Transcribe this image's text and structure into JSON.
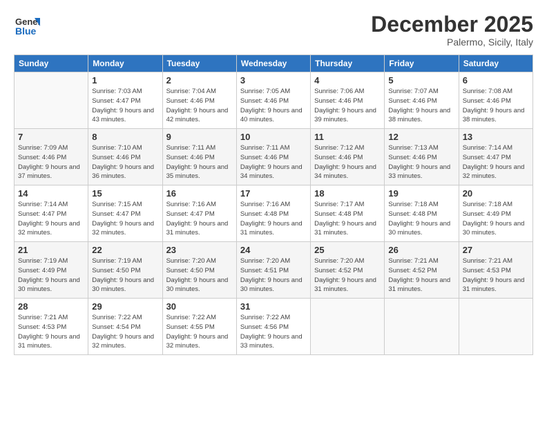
{
  "header": {
    "logo_general": "General",
    "logo_blue": "Blue",
    "month": "December 2025",
    "location": "Palermo, Sicily, Italy"
  },
  "weekdays": [
    "Sunday",
    "Monday",
    "Tuesday",
    "Wednesday",
    "Thursday",
    "Friday",
    "Saturday"
  ],
  "weeks": [
    [
      {
        "day": "",
        "sunrise": "",
        "sunset": "",
        "daylight": ""
      },
      {
        "day": "1",
        "sunrise": "Sunrise: 7:03 AM",
        "sunset": "Sunset: 4:47 PM",
        "daylight": "Daylight: 9 hours and 43 minutes."
      },
      {
        "day": "2",
        "sunrise": "Sunrise: 7:04 AM",
        "sunset": "Sunset: 4:46 PM",
        "daylight": "Daylight: 9 hours and 42 minutes."
      },
      {
        "day": "3",
        "sunrise": "Sunrise: 7:05 AM",
        "sunset": "Sunset: 4:46 PM",
        "daylight": "Daylight: 9 hours and 40 minutes."
      },
      {
        "day": "4",
        "sunrise": "Sunrise: 7:06 AM",
        "sunset": "Sunset: 4:46 PM",
        "daylight": "Daylight: 9 hours and 39 minutes."
      },
      {
        "day": "5",
        "sunrise": "Sunrise: 7:07 AM",
        "sunset": "Sunset: 4:46 PM",
        "daylight": "Daylight: 9 hours and 38 minutes."
      },
      {
        "day": "6",
        "sunrise": "Sunrise: 7:08 AM",
        "sunset": "Sunset: 4:46 PM",
        "daylight": "Daylight: 9 hours and 38 minutes."
      }
    ],
    [
      {
        "day": "7",
        "sunrise": "Sunrise: 7:09 AM",
        "sunset": "Sunset: 4:46 PM",
        "daylight": "Daylight: 9 hours and 37 minutes."
      },
      {
        "day": "8",
        "sunrise": "Sunrise: 7:10 AM",
        "sunset": "Sunset: 4:46 PM",
        "daylight": "Daylight: 9 hours and 36 minutes."
      },
      {
        "day": "9",
        "sunrise": "Sunrise: 7:11 AM",
        "sunset": "Sunset: 4:46 PM",
        "daylight": "Daylight: 9 hours and 35 minutes."
      },
      {
        "day": "10",
        "sunrise": "Sunrise: 7:11 AM",
        "sunset": "Sunset: 4:46 PM",
        "daylight": "Daylight: 9 hours and 34 minutes."
      },
      {
        "day": "11",
        "sunrise": "Sunrise: 7:12 AM",
        "sunset": "Sunset: 4:46 PM",
        "daylight": "Daylight: 9 hours and 34 minutes."
      },
      {
        "day": "12",
        "sunrise": "Sunrise: 7:13 AM",
        "sunset": "Sunset: 4:46 PM",
        "daylight": "Daylight: 9 hours and 33 minutes."
      },
      {
        "day": "13",
        "sunrise": "Sunrise: 7:14 AM",
        "sunset": "Sunset: 4:47 PM",
        "daylight": "Daylight: 9 hours and 32 minutes."
      }
    ],
    [
      {
        "day": "14",
        "sunrise": "Sunrise: 7:14 AM",
        "sunset": "Sunset: 4:47 PM",
        "daylight": "Daylight: 9 hours and 32 minutes."
      },
      {
        "day": "15",
        "sunrise": "Sunrise: 7:15 AM",
        "sunset": "Sunset: 4:47 PM",
        "daylight": "Daylight: 9 hours and 32 minutes."
      },
      {
        "day": "16",
        "sunrise": "Sunrise: 7:16 AM",
        "sunset": "Sunset: 4:47 PM",
        "daylight": "Daylight: 9 hours and 31 minutes."
      },
      {
        "day": "17",
        "sunrise": "Sunrise: 7:16 AM",
        "sunset": "Sunset: 4:48 PM",
        "daylight": "Daylight: 9 hours and 31 minutes."
      },
      {
        "day": "18",
        "sunrise": "Sunrise: 7:17 AM",
        "sunset": "Sunset: 4:48 PM",
        "daylight": "Daylight: 9 hours and 31 minutes."
      },
      {
        "day": "19",
        "sunrise": "Sunrise: 7:18 AM",
        "sunset": "Sunset: 4:48 PM",
        "daylight": "Daylight: 9 hours and 30 minutes."
      },
      {
        "day": "20",
        "sunrise": "Sunrise: 7:18 AM",
        "sunset": "Sunset: 4:49 PM",
        "daylight": "Daylight: 9 hours and 30 minutes."
      }
    ],
    [
      {
        "day": "21",
        "sunrise": "Sunrise: 7:19 AM",
        "sunset": "Sunset: 4:49 PM",
        "daylight": "Daylight: 9 hours and 30 minutes."
      },
      {
        "day": "22",
        "sunrise": "Sunrise: 7:19 AM",
        "sunset": "Sunset: 4:50 PM",
        "daylight": "Daylight: 9 hours and 30 minutes."
      },
      {
        "day": "23",
        "sunrise": "Sunrise: 7:20 AM",
        "sunset": "Sunset: 4:50 PM",
        "daylight": "Daylight: 9 hours and 30 minutes."
      },
      {
        "day": "24",
        "sunrise": "Sunrise: 7:20 AM",
        "sunset": "Sunset: 4:51 PM",
        "daylight": "Daylight: 9 hours and 30 minutes."
      },
      {
        "day": "25",
        "sunrise": "Sunrise: 7:20 AM",
        "sunset": "Sunset: 4:52 PM",
        "daylight": "Daylight: 9 hours and 31 minutes."
      },
      {
        "day": "26",
        "sunrise": "Sunrise: 7:21 AM",
        "sunset": "Sunset: 4:52 PM",
        "daylight": "Daylight: 9 hours and 31 minutes."
      },
      {
        "day": "27",
        "sunrise": "Sunrise: 7:21 AM",
        "sunset": "Sunset: 4:53 PM",
        "daylight": "Daylight: 9 hours and 31 minutes."
      }
    ],
    [
      {
        "day": "28",
        "sunrise": "Sunrise: 7:21 AM",
        "sunset": "Sunset: 4:53 PM",
        "daylight": "Daylight: 9 hours and 31 minutes."
      },
      {
        "day": "29",
        "sunrise": "Sunrise: 7:22 AM",
        "sunset": "Sunset: 4:54 PM",
        "daylight": "Daylight: 9 hours and 32 minutes."
      },
      {
        "day": "30",
        "sunrise": "Sunrise: 7:22 AM",
        "sunset": "Sunset: 4:55 PM",
        "daylight": "Daylight: 9 hours and 32 minutes."
      },
      {
        "day": "31",
        "sunrise": "Sunrise: 7:22 AM",
        "sunset": "Sunset: 4:56 PM",
        "daylight": "Daylight: 9 hours and 33 minutes."
      },
      {
        "day": "",
        "sunrise": "",
        "sunset": "",
        "daylight": ""
      },
      {
        "day": "",
        "sunrise": "",
        "sunset": "",
        "daylight": ""
      },
      {
        "day": "",
        "sunrise": "",
        "sunset": "",
        "daylight": ""
      }
    ]
  ]
}
